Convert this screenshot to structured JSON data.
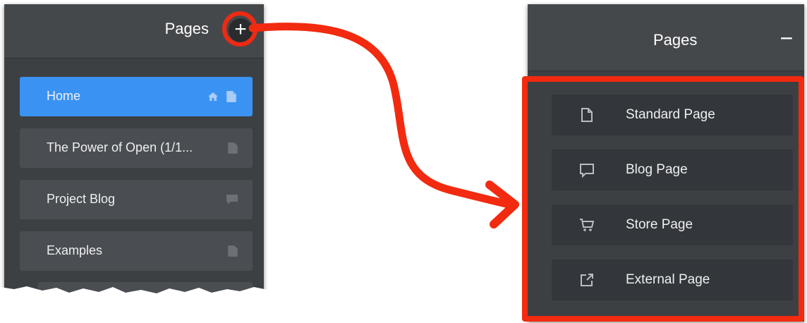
{
  "left_panel": {
    "title": "Pages",
    "add_button": "+",
    "items": [
      {
        "label": "Home",
        "active": true
      },
      {
        "label": "The Power of Open (1/1..."
      },
      {
        "label": "Project Blog"
      },
      {
        "label": "Examples"
      }
    ]
  },
  "right_panel": {
    "title": "Pages",
    "collapse_button": "−",
    "types": [
      {
        "label": "Standard Page",
        "icon": "page-icon"
      },
      {
        "label": "Blog Page",
        "icon": "comment-icon"
      },
      {
        "label": "Store Page",
        "icon": "cart-icon"
      },
      {
        "label": "External Page",
        "icon": "external-link-icon"
      }
    ]
  },
  "colors": {
    "panel": "#3d4043",
    "active": "#3a93f3",
    "highlight": "#f22a0f"
  }
}
